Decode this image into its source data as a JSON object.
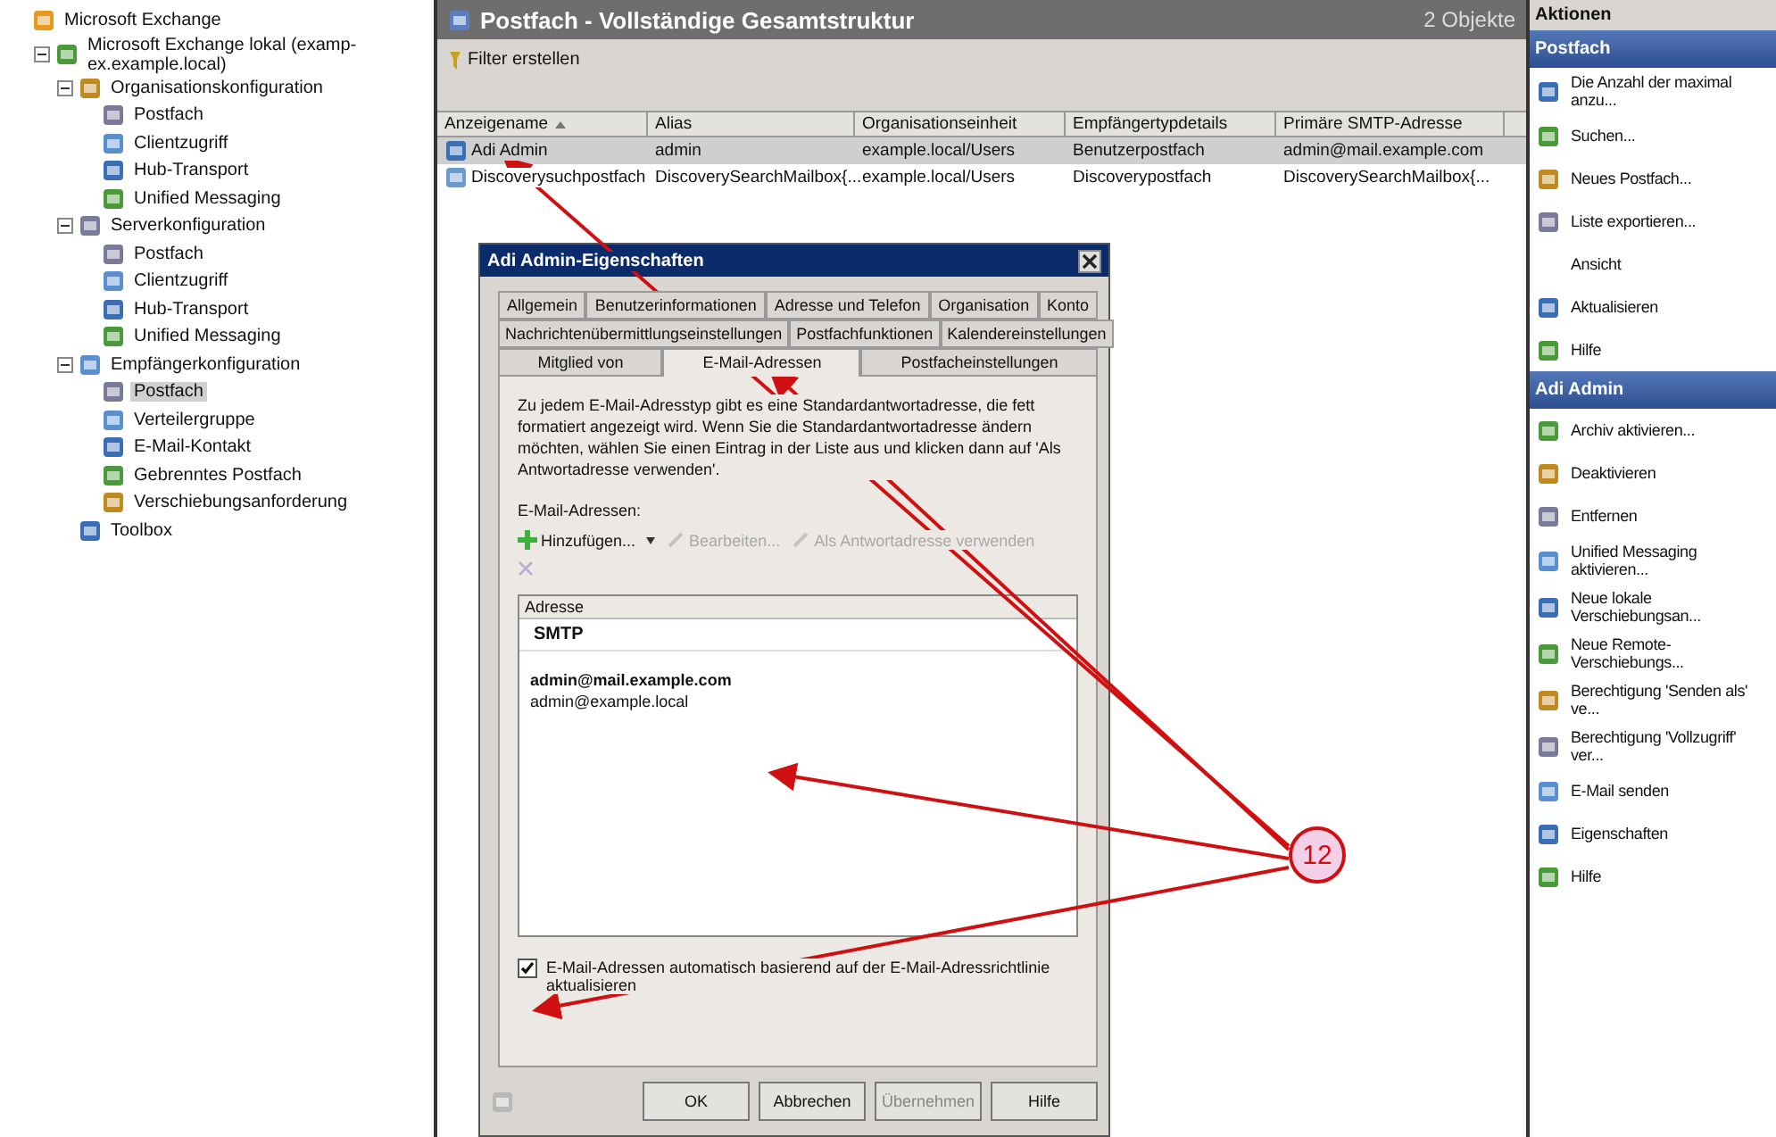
{
  "tree": [
    {
      "label": "Microsoft Exchange",
      "selected": false,
      "children": [
        {
          "label": "Microsoft Exchange lokal (examp-ex.example.local)",
          "expanded": true,
          "selected": false,
          "children": [
            {
              "label": "Organisationskonfiguration",
              "expanded": true,
              "selected": false,
              "children": [
                {
                  "label": "Postfach",
                  "selected": false
                },
                {
                  "label": "Clientzugriff",
                  "selected": false
                },
                {
                  "label": "Hub-Transport",
                  "selected": false
                },
                {
                  "label": "Unified Messaging",
                  "selected": false
                }
              ]
            },
            {
              "label": "Serverkonfiguration",
              "expanded": true,
              "selected": false,
              "children": [
                {
                  "label": "Postfach",
                  "selected": false
                },
                {
                  "label": "Clientzugriff",
                  "selected": false
                },
                {
                  "label": "Hub-Transport",
                  "selected": false
                },
                {
                  "label": "Unified Messaging",
                  "selected": false
                }
              ]
            },
            {
              "label": "Empfängerkonfiguration",
              "expanded": true,
              "selected": false,
              "children": [
                {
                  "label": "Postfach",
                  "selected": true
                },
                {
                  "label": "Verteilergruppe",
                  "selected": false
                },
                {
                  "label": "E-Mail-Kontakt",
                  "selected": false
                },
                {
                  "label": "Gebrenntes Postfach",
                  "selected": false
                },
                {
                  "label": "Verschiebungsanforderung",
                  "selected": false
                }
              ]
            },
            {
              "label": "Toolbox",
              "selected": false
            }
          ]
        }
      ]
    }
  ],
  "main": {
    "title": "Postfach - Vollständige Gesamtstruktur",
    "count": "2 Objekte",
    "filter": "Filter erstellen",
    "table": {
      "columns": [
        "Anzeigename",
        "Alias",
        "Organisationseinheit",
        "Empfängertypdetails",
        "Primäre SMTP-Adresse"
      ],
      "rows": [
        {
          "selected": true,
          "cells": [
            "Adi Admin",
            "admin",
            "example.local/Users",
            "Benutzerpostfach",
            "admin@mail.example.com"
          ]
        },
        {
          "selected": false,
          "cells": [
            "Discoverysuchpostfach",
            "DiscoverySearchMailbox{...",
            "example.local/Users",
            "Discoverypostfach",
            "DiscoverySearchMailbox{..."
          ]
        }
      ]
    }
  },
  "dialog": {
    "title": "Adi Admin-Eigenschaften",
    "tab_rows": [
      [
        {
          "label": "Allgemein",
          "selected": false
        },
        {
          "label": "Benutzerinformationen",
          "selected": false
        },
        {
          "label": "Adresse und Telefon",
          "selected": false
        },
        {
          "label": "Organisation",
          "selected": false
        },
        {
          "label": "Konto",
          "selected": false
        }
      ],
      [
        {
          "label": "Nachrichtenübermittlungseinstellungen",
          "selected": false
        },
        {
          "label": "Postfachfunktionen",
          "selected": false
        },
        {
          "label": "Kalendereinstellungen",
          "selected": false
        }
      ],
      [
        {
          "label": "Mitglied von",
          "selected": false
        },
        {
          "label": "E-Mail-Adressen",
          "selected": true
        },
        {
          "label": "Postfacheinstellungen",
          "selected": false
        }
      ]
    ],
    "description": "Zu jedem E-Mail-Adresstyp gibt es eine Standardantwortadresse, die fett formatiert angezeigt wird. Wenn Sie die Standardantwortadresse ändern möchten, wählen Sie einen Eintrag in der Liste aus und klicken dann auf 'Als Antwortadresse verwenden'.",
    "list_label": "E-Mail-Adressen:",
    "tools": [
      {
        "label": "Hinzufügen...",
        "disabled": false
      },
      {
        "label": "Bearbeiten...",
        "disabled": true
      },
      {
        "label": "Als Antwortadresse verwenden",
        "disabled": true
      }
    ],
    "list_header": "Adresse",
    "group": "SMTP",
    "addresses": [
      {
        "text": "admin@mail.example.com",
        "default": true
      },
      {
        "text": "admin@example.local",
        "default": false
      }
    ],
    "auto_update": {
      "label": "E-Mail-Adressen automatisch basierend auf der E-Mail-Adressrichtlinie aktualisieren",
      "checked": true
    },
    "buttons": [
      {
        "label": "OK",
        "disabled": false
      },
      {
        "label": "Abbrechen",
        "disabled": false
      },
      {
        "label": "Übernehmen",
        "disabled": true
      },
      {
        "label": "Hilfe",
        "disabled": false
      }
    ]
  },
  "actions": {
    "title": "Aktionen",
    "sections": [
      {
        "title": "Postfach",
        "items": [
          {
            "label": "Die Anzahl der maximal anzu...",
            "has_icon": true
          },
          {
            "label": "Suchen...",
            "has_icon": true
          },
          {
            "label": "Neues Postfach...",
            "has_icon": true
          },
          {
            "label": "Liste exportieren...",
            "has_icon": true
          },
          {
            "label": "Ansicht",
            "has_icon": false
          },
          {
            "label": "Aktualisieren",
            "has_icon": true
          },
          {
            "label": "Hilfe",
            "has_icon": true
          }
        ]
      },
      {
        "title": "Adi Admin",
        "items": [
          {
            "label": "Archiv aktivieren...",
            "has_icon": true
          },
          {
            "label": "Deaktivieren",
            "has_icon": true
          },
          {
            "label": "Entfernen",
            "has_icon": true
          },
          {
            "label": "Unified Messaging aktivieren...",
            "has_icon": true
          },
          {
            "label": "Neue lokale Verschiebungsan...",
            "has_icon": true
          },
          {
            "label": "Neue Remote-Verschiebungs...",
            "has_icon": true
          },
          {
            "label": "Berechtigung 'Senden als' ve...",
            "has_icon": true
          },
          {
            "label": "Berechtigung 'Vollzugriff' ver...",
            "has_icon": true
          },
          {
            "label": "E-Mail senden",
            "has_icon": true
          },
          {
            "label": "Eigenschaften",
            "has_icon": true
          },
          {
            "label": "Hilfe",
            "has_icon": true
          }
        ]
      }
    ]
  },
  "callout": "12"
}
